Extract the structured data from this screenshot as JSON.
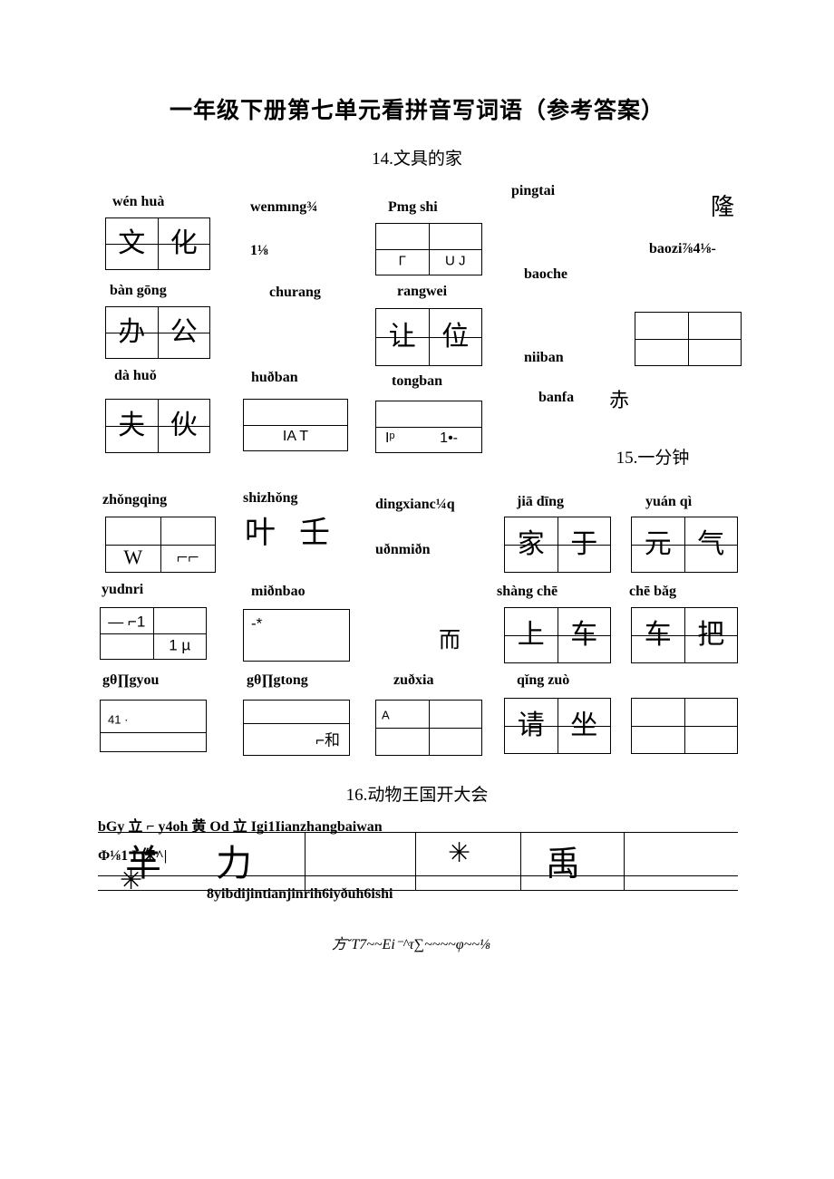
{
  "document": {
    "title": "一年级下册第七单元看拼音写词语（参考答案）"
  },
  "sections": [
    {
      "id": "s14",
      "title": "14.文具的家"
    },
    {
      "id": "s15",
      "title": "15.一分钟"
    },
    {
      "id": "s16",
      "title": "16.动物王国开大会"
    }
  ],
  "section14": {
    "entries": [
      {
        "pinyin": "wén huà",
        "chars": [
          "文",
          "化"
        ]
      },
      {
        "pinyin": "wenmıng¾",
        "chars": []
      },
      {
        "pinyin": "1⅛",
        "chars": []
      },
      {
        "pinyin": "Pmg shi",
        "chars": [
          "Γ",
          "U J"
        ]
      },
      {
        "pinyin": "pingtai",
        "chars": []
      },
      {
        "pinyin": "baozi⅞4⅛-",
        "chars": []
      },
      {
        "pinyin": "隆",
        "chars": []
      },
      {
        "pinyin": "bàn gōng",
        "chars": [
          "办",
          "公"
        ]
      },
      {
        "pinyin": "churang",
        "chars": []
      },
      {
        "pinyin": "rangwei",
        "chars": [
          "让",
          "位"
        ]
      },
      {
        "pinyin": "baoche",
        "chars": []
      },
      {
        "pinyin": "niiban",
        "chars": []
      },
      {
        "pinyin": "dà   huǒ",
        "chars": [
          "夫",
          "伙"
        ]
      },
      {
        "pinyin": "huðban",
        "chars": [
          "IA   T"
        ]
      },
      {
        "pinyin": "tongban",
        "chars": [
          "Iᵖ",
          "1•-"
        ]
      },
      {
        "pinyin": "banfa",
        "chars": [
          "赤"
        ]
      }
    ]
  },
  "section15": {
    "entries": [
      {
        "pinyin": "zhǒngqing",
        "chars": [
          "W",
          "⌐⌐"
        ]
      },
      {
        "pinyin": "shizhǒng",
        "chars": [
          "叶",
          "壬"
        ]
      },
      {
        "pinyin": "dingxianc¼q",
        "chars": []
      },
      {
        "pinyin": "uðnmiðn",
        "chars": []
      },
      {
        "pinyin": "jiā   dīng",
        "chars": [
          "家",
          "于"
        ]
      },
      {
        "pinyin": "yuán   qì",
        "chars": [
          "元",
          "气"
        ]
      },
      {
        "pinyin": "yudnri",
        "chars": [
          "—   ⌐1",
          "1 µ"
        ]
      },
      {
        "pinyin": "miðnbao",
        "chars": [
          "-*"
        ]
      },
      {
        "pinyin": "而",
        "chars": []
      },
      {
        "pinyin": "shàng chē",
        "chars": [
          "上",
          "车"
        ]
      },
      {
        "pinyin": "chē  bǎg",
        "chars": [
          "车",
          "把"
        ]
      },
      {
        "pinyin": "gθ∏gyou",
        "chars": [
          "41  ·"
        ]
      },
      {
        "pinyin": "gθ∏gtong",
        "chars": [
          "⌐和"
        ]
      },
      {
        "pinyin": "zuðxia",
        "chars": [
          "A"
        ]
      },
      {
        "pinyin": "qǐng   zuò",
        "chars": [
          "请",
          "坐"
        ]
      }
    ]
  },
  "section16": {
    "garbled_lines": [
      "bGy 立  ⌐   y4oh 黄 Od 立 Igi1Iianzhangbaiwan",
      "Φ⅛1      I 侏^|",
      "8yibdijintianjinrih6iyðuh6ishi",
      "方ˇT7~~Ei⁻^τ∑~~~~φ~~⅛"
    ],
    "chars": [
      "羊",
      "力",
      "禹"
    ]
  }
}
